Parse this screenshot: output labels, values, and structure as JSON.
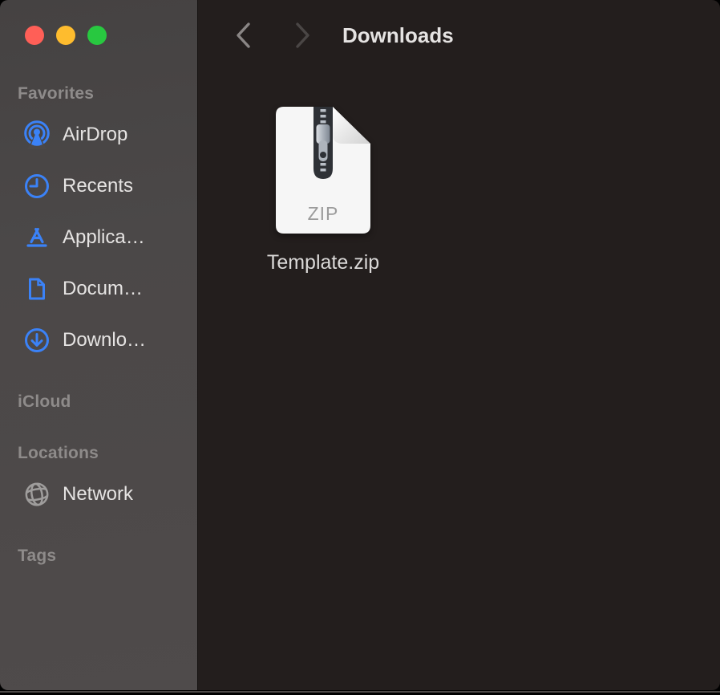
{
  "toolbar": {
    "title": "Downloads"
  },
  "sidebar": {
    "sections": {
      "favorites": {
        "label": "Favorites"
      },
      "icloud": {
        "label": "iCloud"
      },
      "locations": {
        "label": "Locations"
      },
      "tags": {
        "label": "Tags"
      }
    },
    "favorites_items": [
      {
        "label": "AirDrop",
        "icon": "airdrop-icon"
      },
      {
        "label": "Recents",
        "icon": "clock-icon"
      },
      {
        "label": "Applica…",
        "icon": "appstore-icon"
      },
      {
        "label": "Docum…",
        "icon": "document-icon"
      },
      {
        "label": "Downlo…",
        "icon": "download-circle-icon"
      }
    ],
    "locations_items": [
      {
        "label": "Network",
        "icon": "globe-icon"
      }
    ]
  },
  "content": {
    "file": {
      "name": "Template.zip",
      "badge": "ZIP",
      "type": "zip-archive"
    }
  },
  "colors": {
    "sidebar_bg": "#4b4848",
    "content_bg": "#231e1d",
    "accent_blue": "#3b82f7",
    "traffic_close": "#ff5f57",
    "traffic_minimize": "#febc2e",
    "traffic_zoom": "#28c840",
    "section_header_text": "#8e8b8a",
    "item_text": "#e6e4e3"
  }
}
